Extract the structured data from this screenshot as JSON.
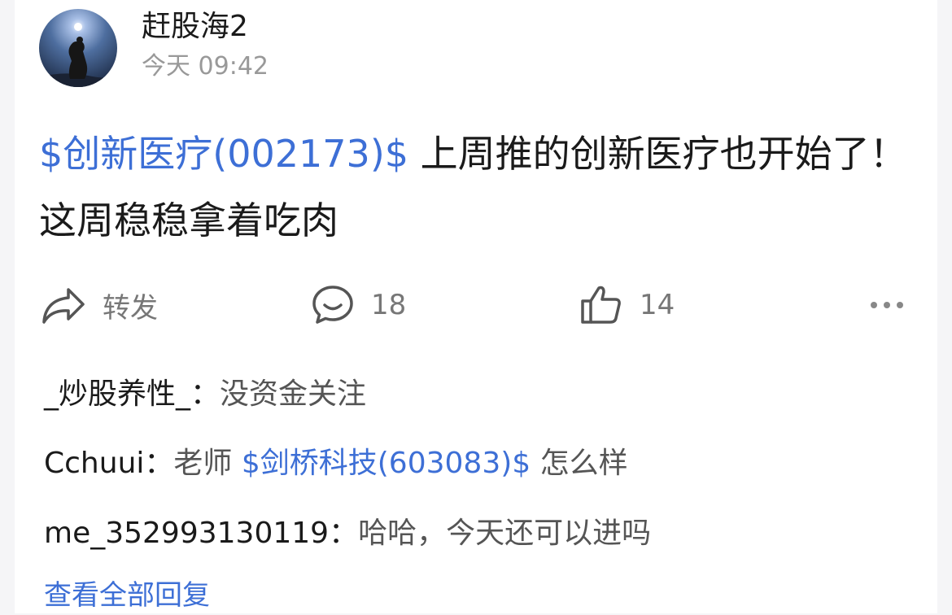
{
  "post": {
    "author": "赶股海2",
    "time": "今天 09:42",
    "stock_tag": "$创新医疗(002173)$",
    "body": " 上周推的创新医疗也开始了！这周稳稳拿着吃肉"
  },
  "actions": {
    "repost_label": "转发",
    "comment_count": "18",
    "like_count": "14"
  },
  "comments": [
    {
      "user": "_炒股养性_",
      "sep": "：",
      "text_before": "没资金关注",
      "stock": "",
      "text_after": ""
    },
    {
      "user": "Cchuui",
      "sep": "：",
      "text_before": "老师 ",
      "stock": "$剑桥科技(603083)$",
      "text_after": " 怎么样"
    },
    {
      "user": "me_352993130119",
      "sep": "：",
      "text_before": "哈哈，今天还可以进吗",
      "stock": "",
      "text_after": ""
    }
  ],
  "view_all_label": "查看全部回复",
  "colors": {
    "link": "#3d6fd6",
    "muted": "#999999",
    "text": "#1a1a1a"
  },
  "icons": [
    "avatar-silhouette",
    "share-arrow-icon",
    "comment-bubble-icon",
    "thumbs-up-icon",
    "more-dots-icon"
  ]
}
